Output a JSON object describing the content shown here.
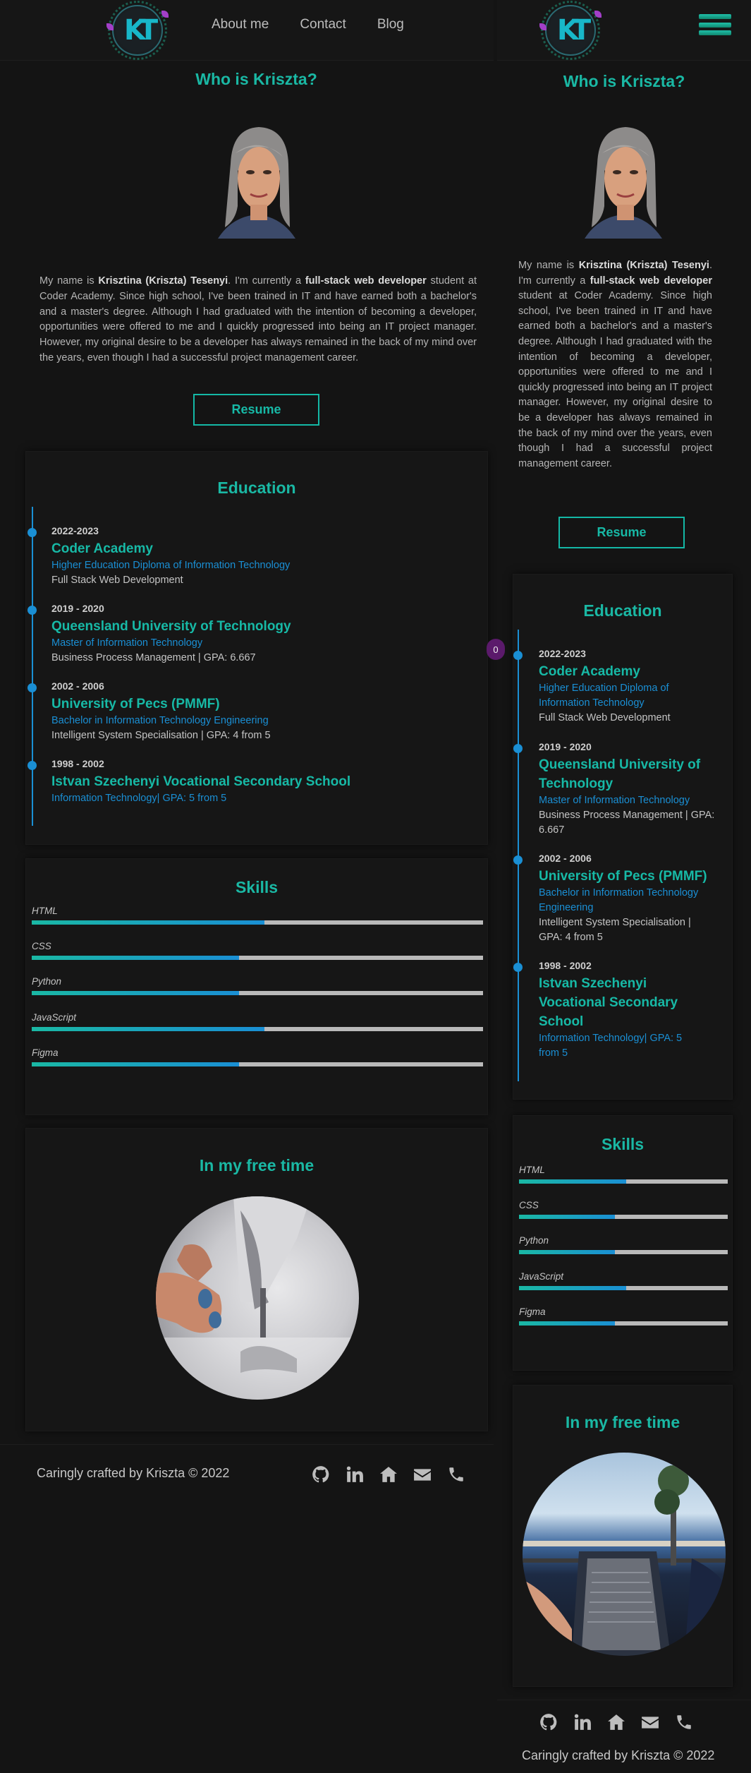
{
  "nav": {
    "links": [
      "About me",
      "Contact",
      "Blog"
    ],
    "logo_text": "KT"
  },
  "about": {
    "title": "Who is Kriszta?",
    "bio_intro": "My name is ",
    "bio_name": "Krisztina (Kriszta) Tesenyi",
    "bio_mid": ". I'm currently a ",
    "bio_role": "full-stack web developer",
    "bio_rest": " student at Coder Academy. Since high school, I've been trained in IT and have earned both a bachelor's and a master's degree. Although I had graduated with the intention of becoming a developer, opportunities were offered to me and I quickly progressed into being an IT project manager. However, my original desire to be a developer has always remained in the back of my mind over the years, even though I had a successful project management career.",
    "resume_label": "Resume"
  },
  "education": {
    "title": "Education",
    "items": [
      {
        "years": "2022-2023",
        "school": "Coder Academy",
        "degree": "Higher Education Diploma of Information Technology",
        "detail": "Full Stack Web Development"
      },
      {
        "years": "2019 - 2020",
        "school": "Queensland University of Technology",
        "degree": "Master of Information Technology",
        "detail": "Business Process Management | GPA: 6.667"
      },
      {
        "years": "2002 - 2006",
        "school": "University of Pecs (PMMF)",
        "degree": "Bachelor in Information Technology Engineering",
        "detail": "Intelligent System Specialisation | GPA: 4 from 5"
      },
      {
        "years": "1998 - 2002",
        "school": "Istvan Szechenyi Vocational Secondary School",
        "degree": "Information Technology| GPA: 5 from 5",
        "detail": ""
      }
    ]
  },
  "skills": {
    "title": "Skills",
    "items": [
      {
        "name": "HTML",
        "level": 0.515
      },
      {
        "name": "CSS",
        "level": 0.46
      },
      {
        "name": "Python",
        "level": 0.46
      },
      {
        "name": "JavaScript",
        "level": 0.515
      },
      {
        "name": "Figma",
        "level": 0.46
      }
    ]
  },
  "free_time": {
    "title": "In my free time"
  },
  "footer": {
    "text": "Caringly crafted by Kriszta © 2022",
    "icons": [
      "github-icon",
      "linkedin-icon",
      "home-icon",
      "envelope-icon",
      "phone-icon"
    ]
  },
  "floating_badge": "0",
  "colors": {
    "accent": "#1ab8a4",
    "link_blue": "#1a8fd4",
    "background": "#141414"
  }
}
